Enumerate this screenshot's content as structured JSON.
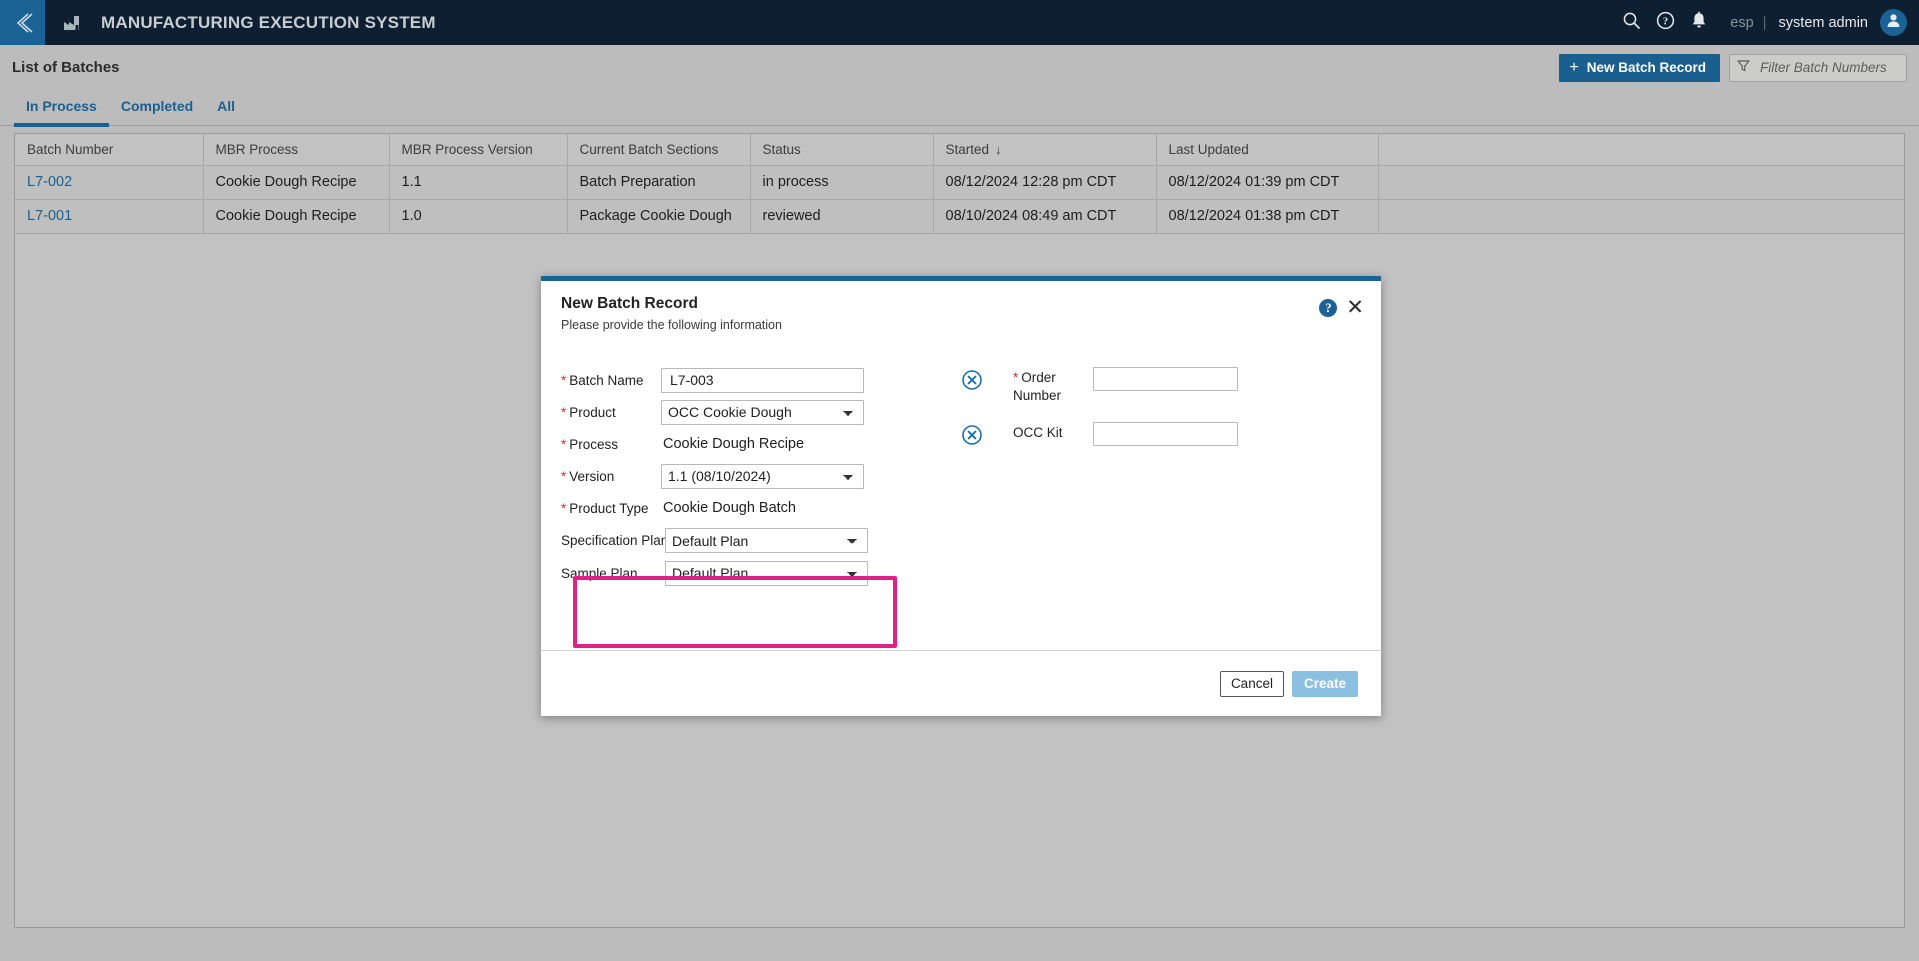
{
  "header": {
    "back_icon": "chevron-left-icon",
    "logo_icon": "factory-icon",
    "title": "MANUFACTURING EXECUTION SYSTEM",
    "search_icon": "search-icon",
    "help_icon": "help-circle-icon",
    "notification_icon": "bell-icon",
    "language": "esp",
    "separator": "|",
    "user": "system admin",
    "avatar_icon": "user-avatar-icon"
  },
  "page": {
    "title": "List of Batches",
    "new_batch_button": "New Batch Record",
    "new_batch_plus": "+",
    "filter_icon": "funnel-icon",
    "filter_placeholder": "Filter Batch Numbers",
    "filter_value": ""
  },
  "tabs": [
    {
      "label": "In Process",
      "active": true
    },
    {
      "label": "Completed",
      "active": false
    },
    {
      "label": "All",
      "active": false
    }
  ],
  "table": {
    "columns": [
      "Batch Number",
      "MBR Process",
      "MBR Process Version",
      "Current Batch Sections",
      "Status",
      "Started",
      "Last Updated",
      ""
    ],
    "sorted_column": "Started",
    "sort_arrow": "↓",
    "rows": [
      {
        "batch_number": "L7-002",
        "mbr_process": "Cookie Dough Recipe",
        "mbr_process_version": "1.1",
        "current_batch_sections": "Batch Preparation",
        "status": "in process",
        "started": "08/12/2024 12:28 pm CDT",
        "last_updated": "08/12/2024 01:39 pm CDT",
        "extra": ""
      },
      {
        "batch_number": "L7-001",
        "mbr_process": "Cookie Dough Recipe",
        "mbr_process_version": "1.0",
        "current_batch_sections": "Package Cookie Dough",
        "status": "reviewed",
        "started": "08/10/2024 08:49 am CDT",
        "last_updated": "08/12/2024 01:38 pm CDT",
        "extra": ""
      }
    ]
  },
  "modal": {
    "title": "New Batch Record",
    "subtitle": "Please provide the following information",
    "help_icon": "help-circle-icon",
    "help_glyph": "?",
    "close_icon": "close-icon",
    "close_glyph": "✕",
    "fields": {
      "batch_name_label": "Batch Name",
      "batch_name_value": "L7-003",
      "product_label": "Product",
      "product_value": "OCC Cookie Dough",
      "process_label": "Process",
      "process_value": "Cookie Dough Recipe",
      "version_label": "Version",
      "version_value": "1.1 (08/10/2024)",
      "product_type_label": "Product Type",
      "product_type_value": "Cookie Dough Batch",
      "specification_plan_label": "Specification Plan",
      "specification_plan_value": "Default Plan",
      "sample_plan_label": "Sample Plan",
      "sample_plan_value": "Default Plan",
      "order_number_label": "Order Number",
      "order_number_value": "",
      "occ_kit_label": "OCC Kit",
      "occ_kit_value": "",
      "required_marker": "*",
      "clear_icon": "circle-x-icon"
    },
    "footer": {
      "cancel_label": "Cancel",
      "create_label": "Create"
    },
    "highlight_color": "#e0218a"
  },
  "colors": {
    "header_bg": "#0e1f32",
    "accent_blue": "#1b6295",
    "link_blue": "#1b5f8f",
    "page_bg": "#bcbcbc",
    "highlight_pink": "#e0218a",
    "required_red": "#c0392b"
  }
}
